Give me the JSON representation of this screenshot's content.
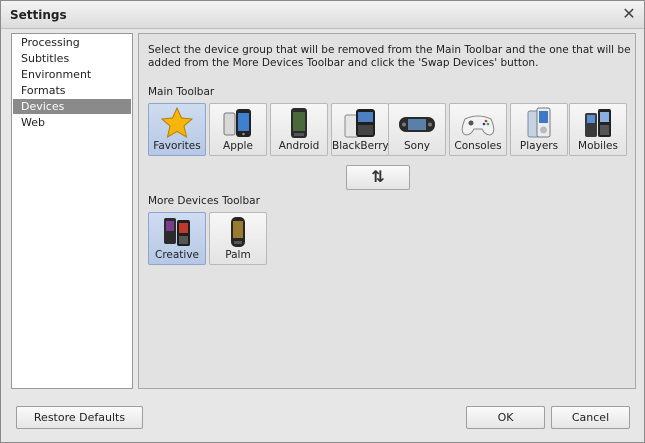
{
  "window": {
    "title": "Settings"
  },
  "sidebar": {
    "items": [
      {
        "label": "Processing"
      },
      {
        "label": "Subtitles"
      },
      {
        "label": "Environment"
      },
      {
        "label": "Formats"
      },
      {
        "label": "Devices"
      },
      {
        "label": "Web"
      }
    ],
    "selected": "Devices"
  },
  "main": {
    "instructions": "Select the device group that will be removed from the Main Toolbar and the one that will be added from the More Devices Toolbar and click the 'Swap Devices' button.",
    "main_toolbar_label": "Main Toolbar",
    "main_toolbar": [
      {
        "label": "Favorites",
        "icon": "star-icon",
        "selected": true
      },
      {
        "label": "Apple",
        "icon": "iphone-icon"
      },
      {
        "label": "Android",
        "icon": "android-phone-icon"
      },
      {
        "label": "BlackBerry",
        "icon": "blackberry-icon"
      },
      {
        "label": "Sony",
        "icon": "psp-icon"
      },
      {
        "label": "Consoles",
        "icon": "gamepad-icon"
      },
      {
        "label": "Players",
        "icon": "media-player-icon"
      },
      {
        "label": "Mobiles",
        "icon": "mobile-phone-icon"
      }
    ],
    "swap_button_glyph": "⇅",
    "more_toolbar_label": "More Devices Toolbar",
    "more_toolbar": [
      {
        "label": "Creative",
        "icon": "creative-player-icon",
        "selected": true
      },
      {
        "label": "Palm",
        "icon": "palm-phone-icon"
      }
    ]
  },
  "footer": {
    "restore_label": "Restore Defaults",
    "ok_label": "OK",
    "cancel_label": "Cancel"
  },
  "colors": {
    "selected_bg": "#b6c8e6",
    "sidebar_selected": "#8a8a8a",
    "star": "#f5b50a"
  }
}
